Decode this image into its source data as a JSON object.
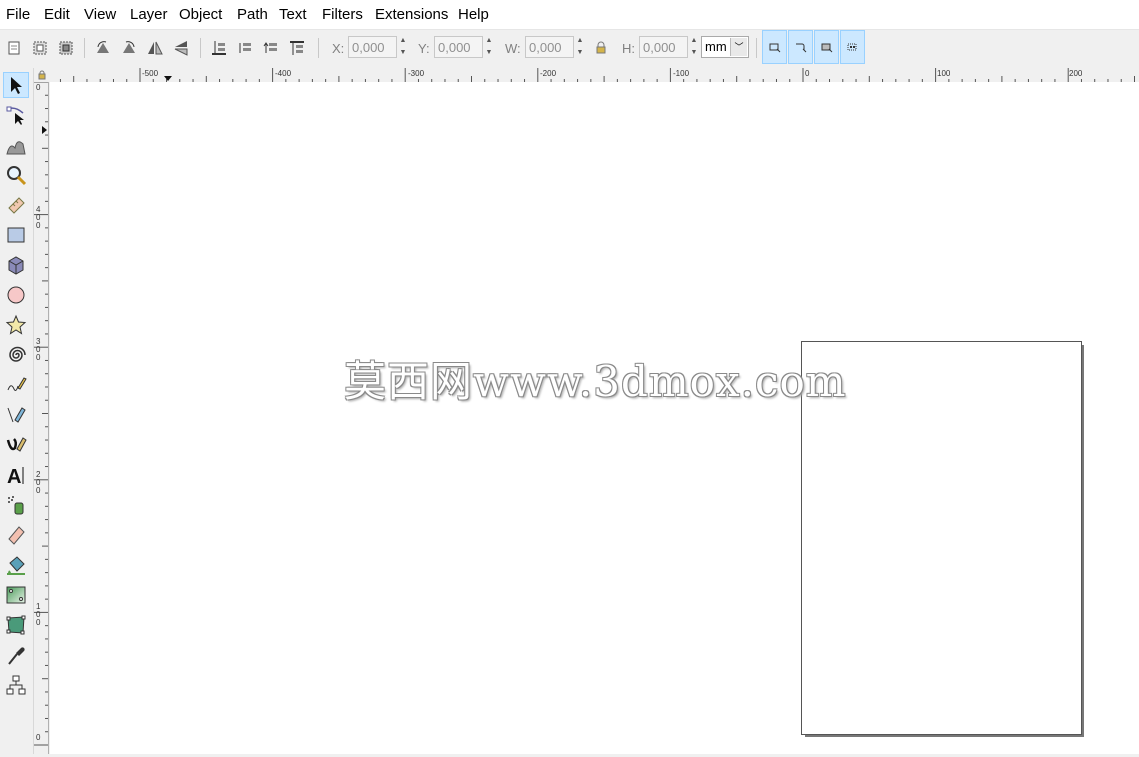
{
  "menu": {
    "items": [
      {
        "label": "File"
      },
      {
        "label": "Edit"
      },
      {
        "label": "View"
      },
      {
        "label": "Layer"
      },
      {
        "label": "Object"
      },
      {
        "label": "Path"
      },
      {
        "label": "Text"
      },
      {
        "label": "Filters"
      },
      {
        "label": "Extensions"
      },
      {
        "label": "Help"
      }
    ]
  },
  "toolbar": {
    "x": {
      "label": "X:",
      "value": "0,000"
    },
    "y": {
      "label": "Y:",
      "value": "0,000"
    },
    "w": {
      "label": "W:",
      "value": "0,000"
    },
    "h": {
      "label": "H:",
      "value": "0,000"
    },
    "unit": "mm"
  },
  "ruler": {
    "horizontal": [
      "-500",
      "-400",
      "-300",
      "-200",
      "-100",
      "0",
      "100",
      "200"
    ],
    "vertical": [
      "0",
      "4\n0\n0",
      "3\n0\n0",
      "2\n0\n0",
      "1\n0\n0",
      "0"
    ]
  },
  "canvas": {
    "watermark": "莫西网www.3dmox.com"
  },
  "colors": {
    "accent": "#cce8ff",
    "accent_border": "#99d1ff",
    "canvas": "#ffffff",
    "chrome": "#f0f0f0"
  },
  "icons": {
    "tools": [
      "selector-arrow-icon",
      "node-editor-icon",
      "tweak-icon",
      "zoom-icon",
      "measure-icon",
      "rectangle-icon",
      "3d-box-icon",
      "ellipse-icon",
      "star-icon",
      "spiral-icon",
      "pencil-icon",
      "pen-icon",
      "calligraphy-icon",
      "text-icon",
      "spray-icon",
      "eraser-icon",
      "paint-bucket-icon",
      "gradient-icon",
      "mesh-icon",
      "dropper-icon",
      "connector-icon"
    ]
  }
}
